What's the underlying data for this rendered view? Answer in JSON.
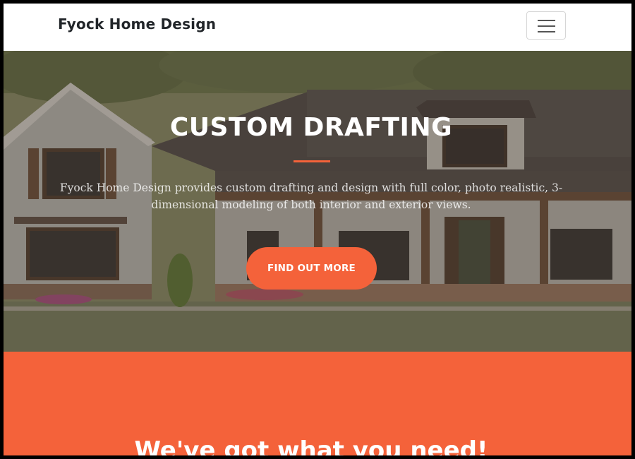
{
  "navbar": {
    "brand": "Fyock Home Design",
    "toggler_icon": "hamburger-menu-icon"
  },
  "hero": {
    "title": "CUSTOM DRAFTING",
    "description": "Fyock Home Design provides custom drafting and design with full color, photo realistic, 3-dimensional modeling of both interior and exterior views.",
    "button_label": "Find Out More"
  },
  "about": {
    "title": "We've got what you need!"
  },
  "colors": {
    "primary": "#f4623a",
    "navbar_bg": "#ffffff",
    "text_dark": "#212529"
  }
}
